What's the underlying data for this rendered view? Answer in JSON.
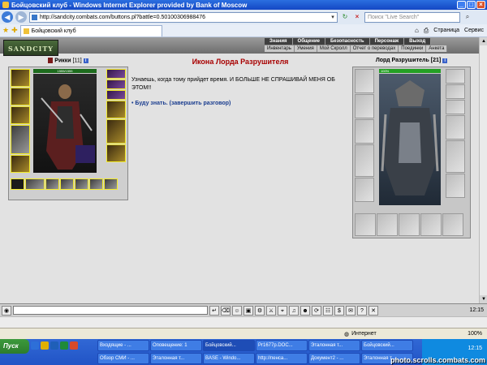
{
  "window": {
    "title": "Бойцовский клуб - Windows Internet Explorer provided by Bank of Moscow"
  },
  "address": {
    "url": "http://sandcity.combats.com/buttons.pl?battle=0.50100306988476",
    "search_placeholder": "Поиск \"Live Search\""
  },
  "tab": {
    "label": "Бойцовский клуб"
  },
  "commandbar": {
    "page": "Страница",
    "tools": "Сервис"
  },
  "game": {
    "logo": "SANDCITY",
    "menu": [
      "Знания",
      "Общение",
      "Безопасность",
      "Персонаж",
      "Выход"
    ],
    "submenu": [
      "Инвентарь",
      "Умения",
      "Мой Скролл",
      "Отчет о переводах",
      "Поединки",
      "Анкета"
    ]
  },
  "player": {
    "name": "Рикки",
    "level": "[11]",
    "hp": "1555/1555",
    "info": "i"
  },
  "dialog": {
    "title": "Икона Лорда Разрушителя",
    "text": "Узнаешь, когда тому прийдет время. И БОЛЬШЕ НЕ СПРАШИВАЙ МЕНЯ ОБ ЭТОМ!!",
    "link": "• Буду знать. (завершить разговор)"
  },
  "boss": {
    "name": "Лорд Разрушитель",
    "level": "[21]",
    "hp": "100%",
    "info": "i"
  },
  "gamebar": {
    "clock": "12:15"
  },
  "status": {
    "zone": "Интернет",
    "zoom": "100%"
  },
  "taskbar": {
    "start": "Пуск",
    "tasks": [
      "Входящие - ...",
      "Оповещение: 1",
      "Бойцовский...",
      "Pr1677p.DOC...",
      "Эталонная т...",
      "Бойцовский...",
      "Обзор СМИ - ...",
      "Эталонная т...",
      "BASE - Windo...",
      "http://пенса...",
      "Документ2 - ...",
      "Эталонная т..."
    ],
    "time": "12:15",
    "watermark": "photo.scrolls.combats.com"
  }
}
